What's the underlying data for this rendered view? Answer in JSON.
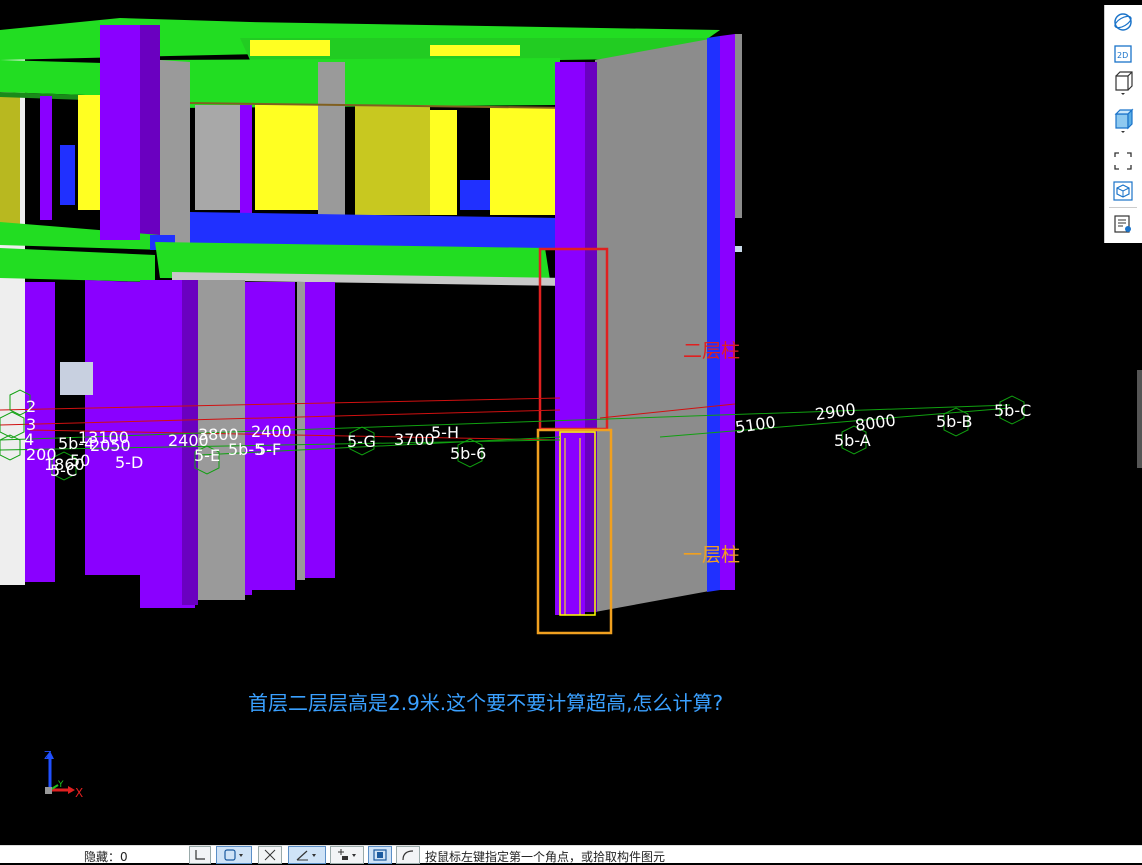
{
  "annotations": {
    "second_floor_column": "二层柱",
    "first_floor_column": "一层柱",
    "question": "首层二层层高是2.9米.这个要不要计算超高,怎么计算?"
  },
  "grid_labels": {
    "left_numbers": [
      "2",
      "3",
      "4"
    ],
    "dim_200": "200",
    "dim_1860": "1860",
    "dim_50": "50",
    "axis_5c": "5-C",
    "axis_5b4": "5b-4",
    "dim_13100": "13100",
    "dim_2050": "2050",
    "axis_5d": "5-D",
    "dim_2400a": "2400",
    "dim_3800": "3800",
    "axis_5e": "5-E",
    "dim_2400b": "2400",
    "axis_5b5": "5b-5",
    "axis_5f": "5-F",
    "axis_5g": "5-G",
    "dim_3700": "3700",
    "axis_5h": "5-H",
    "axis_5b6": "5b-6",
    "dim_5100": "5100",
    "dim_2900": "2900",
    "dim_8000": "8000",
    "axis_5bA": "5b-A",
    "axis_5bB": "5b-B",
    "axis_5bC": "5b-C"
  },
  "axis_indicator": {
    "z": "Z",
    "y": "Y",
    "x": "X"
  },
  "toolbar": {
    "items": [
      "orbit-icon",
      "2d-view-icon",
      "3d-box-icon",
      "shaded-box-icon",
      "fit-view-icon",
      "component-3d-icon",
      "layer-settings-icon"
    ],
    "label_2d": "2D"
  },
  "statusbar": {
    "hidden_count": "隐藏：0",
    "hint": "按鼠标左键指定第一个角点，或拾取构件图元"
  },
  "colors": {
    "background": "#000000",
    "slab_green": "#22dd22",
    "column_purple": "#8a00ff",
    "wall_gray": "#8c8c8c",
    "beam_blue": "#2030ff",
    "window_yellow": "#ffff22",
    "highlight_red": "#e02020",
    "highlight_orange": "#f0a020",
    "question_blue": "#3aa0ff"
  }
}
